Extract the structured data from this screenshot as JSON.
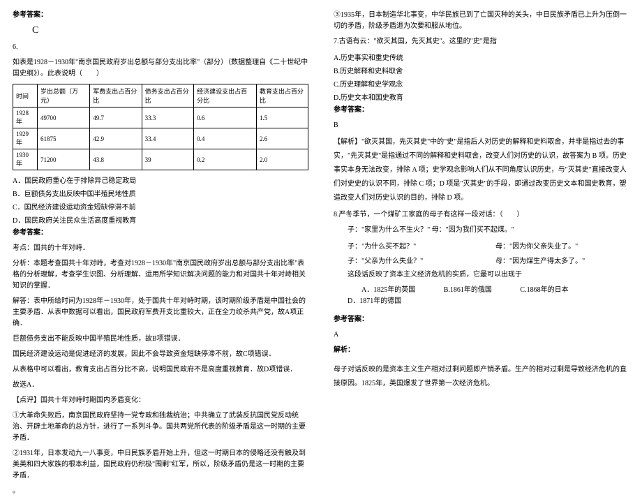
{
  "left": {
    "ans_label": "参考答案：",
    "ans_c": "C",
    "q6_num": "6.",
    "q6_stem": "如表是1928－1930年\"南京国民政府岁出总额与部分支出比率\"（部分）（数据整理自《二十世纪中国史纲》）。此表说明（　　）",
    "table": {
      "h": [
        "时间",
        "岁出总额（万元）",
        "军费支出占百分比",
        "债务支出占百分比",
        "经济建设支出占百分比",
        "教育支出占百分比"
      ],
      "r1": [
        "1928年",
        "49700",
        "49.7",
        "33.3",
        "0.6",
        "1.5"
      ],
      "r2": [
        "1929年",
        "61875",
        "42.9",
        "33.4",
        "0.4",
        "2.6"
      ],
      "r3": [
        "1930年",
        "71200",
        "43.8",
        "39",
        "0.2",
        "2.0"
      ]
    },
    "q6_opts": {
      "A": "A．国民政府重心在于排除异己稳定政局",
      "B": "B．巨额债务支出反映中国半殖民地性质",
      "C": "C．国民经济建设运动资金短缺停滞不前",
      "D": "D．国民政府关注民众生活高度重视教育"
    },
    "q6_ans_label": "参考答案：",
    "q6_kaodian": "考点：国共的十年对峙．",
    "q6_fenxi": "分析：本题考查国共十年对峙，考查对1928－1930年\"南京国民政府岁出总额与部分支出比率\"表格的分析理解，考查学生识图、分析理解、运用所学知识解决问题的能力和对国共十年对峙相关知识的掌握．",
    "q6_jieda1": "解答：表中所给时间为1928年－1930年，处于国共十年对峙时期，该时期阶级矛盾是中国社会的主要矛盾．从表中数据可以看出，国民政府军费开支比重较大，正在全力绞杀共产党，故A项正确．",
    "q6_jieda2": "巨额债务支出不能反映中国半殖民地性质，故B项错误．",
    "q6_jieda3": "国民经济建设运动是促进经济的发展，因此不会导致资金短缺停滞不前，故C项错误．",
    "q6_jieda4": "从表格中可以看出，教育支出占百分比不高，说明国民政府不是高度重视教育．故D项错误．",
    "q6_jieda5": "故选A．",
    "q6_dp_head": "【点评】国共十年对峙时期国内矛盾变化：",
    "q6_dp1": "①大革命失败后，南京国民政府坚持一党专政和独裁统治；中共确立了武装反抗国民党反动统治、开辟土地革命的总方针，进行了一系列斗争。国共两党所代表的阶级矛盾是这一时期的主要矛盾．",
    "q6_dp2": "②1931年，日本发动九一八事变，中日民族矛盾开始上升，但这一时期日本的侵略还没有触及到美英和四大家族的根本利益，国民政府仍积极\"围剿\"红军，所以，阶级矛盾仍是这一时期的主要矛盾．",
    "q6_dot": "。"
  },
  "right": {
    "r1": "③1935年，日本制造华北事变，中华民族已到了亡国灭种的关头，中日民族矛盾已上升为压倒一切的矛盾，阶级矛盾退为次要和服从地位。",
    "q7_stem": "7.古语有云：\"欲灭其国，先灭其史\"。这里的\"史\"是指",
    "q7_opts": {
      "A": "A.历史事实和重史传统",
      "B": "B.历史解释和史料取舍",
      "C": "C.历史理解和史学观念",
      "D": "D.历史文本和国史教育"
    },
    "q7_ans_label": "参考答案：",
    "q7_ans": "B",
    "q7_jie": "【解析】\"欲灭其国，先灭其史\"中的\"史\"是指后人对历史的解释和史料取舍，并非是指过去的事实，\"先灭其史\"是指通过不同的解释和史料取舍，改变人们对历史的认识，故答案为 B 项。历史事实本身无法改变，排除 A 项；史学观念影响人们从不同角度认识历史，与\"灭其史\"直接改变人们对史史的认识不同，排除 C 项；D 项是\"灭其史\"的手段，即通过改变历史文本和国史教育，塑造改变人们对历史认识的目的，排除 D 项。",
    "q8_stem": "8.严冬季节，一个煤矿工家庭的母子有这样一段对话：（　　）",
    "q8_d1z": "子：\"家里为什么不生火？\"",
    "q8_d1m": "母：\"因为我们买不起煤。\"",
    "q8_d2z": "子：\"为什么买不起？\"",
    "q8_d2m": "母：\"因为你父亲失业了。\"",
    "q8_d3z": "子：\"父亲为什么失业？\"",
    "q8_d3m": "母：\"因为煤生产得太多了。\"",
    "q8_note": "这段话反映了资本主义经济危机的实质，它最可以出现于",
    "q8_opts": {
      "A": "A．1825年的英国",
      "B": "B.1861年的俄国",
      "C": "C.1868年的日本",
      "D": "D．1871年的德国"
    },
    "q8_ans_label": "参考答案：",
    "q8_ans": "A",
    "q8_jx_label": "解析：",
    "q8_jx": "母子对话反映的是资本主义生产相对过剩问题即产销矛盾。生产的相对过剩是导致经济危机的直接原因。1825年，英国爆发了世界第一次经济危机。"
  }
}
